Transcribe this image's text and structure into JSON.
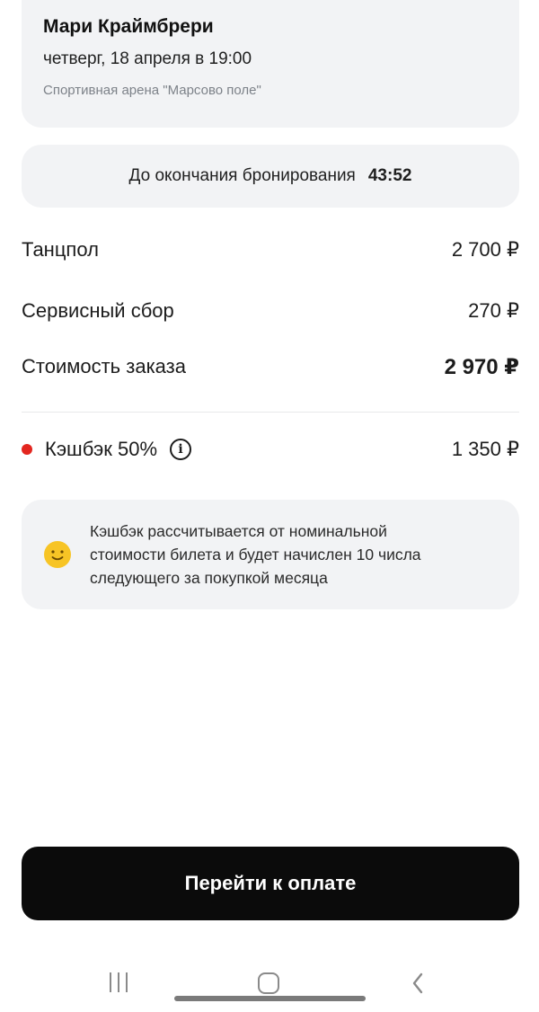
{
  "event": {
    "title": "Мари Краймбрери",
    "date": "четверг, 18 апреля в 19:00",
    "venue": "Спортивная арена \"Марсово поле\""
  },
  "booking_timer": {
    "label": "До окончания бронирования",
    "value": "43:52"
  },
  "order": {
    "dance_floor_label": "Танцпол",
    "dance_floor_price": "2 700 ₽",
    "service_fee_label": "Сервисный сбор",
    "service_fee_price": "270 ₽",
    "total_label": "Стоимость заказа",
    "total_price": "2 970 ₽"
  },
  "cashback": {
    "label": "Кэшбэк 50%",
    "amount": "1 350 ₽",
    "dot_color": "#e3261f"
  },
  "note": {
    "icon": "smiley-icon",
    "text_line_1": "Кэшбэк рассчитывается от номинальной",
    "text_line_2": "стоимости билета и будет начислен 10 числа",
    "text_line_3": "следующего за покупкой месяца"
  },
  "pay_button": {
    "label": "Перейти к оплате",
    "background": "#0b0b0b"
  },
  "navigation": {
    "recent_icon": "recent-apps-icon",
    "home_icon": "home-icon",
    "back_icon": "back-icon"
  }
}
